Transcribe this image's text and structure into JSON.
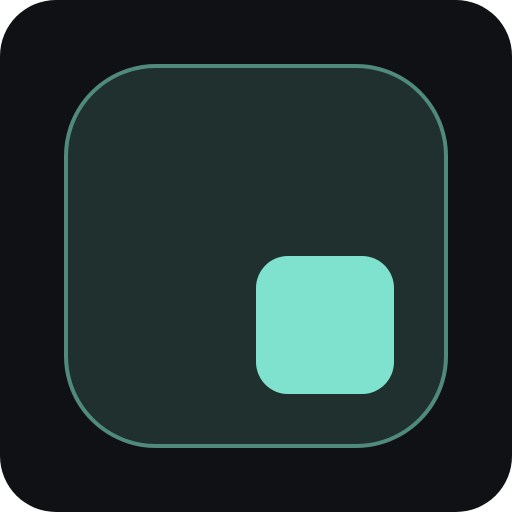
{
  "icon": {
    "name": "stop-icon",
    "colors": {
      "background": "#0f1115",
      "frame_fill": "#1f302e",
      "frame_border": "#4f8a7c",
      "symbol": "#7ee2cf"
    }
  }
}
